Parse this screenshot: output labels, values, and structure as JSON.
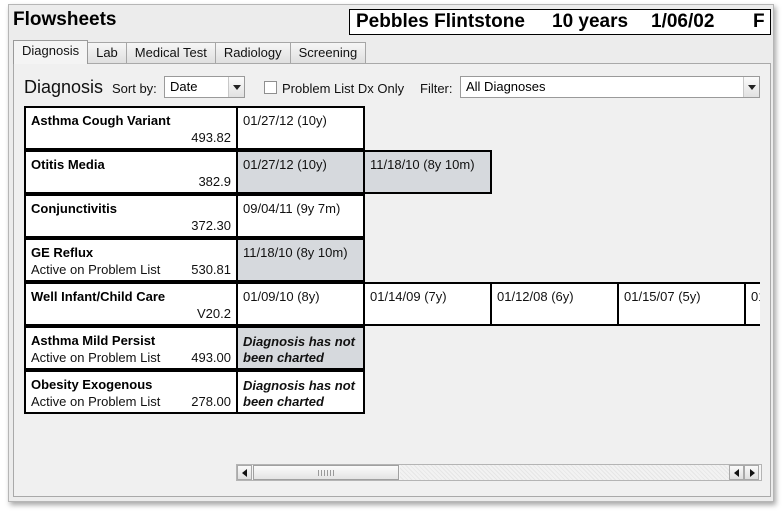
{
  "window": {
    "title": "Flowsheets"
  },
  "patient": {
    "name": "Pebbles Flintstone",
    "age": "10 years",
    "dob": "1/06/02",
    "sex": "F"
  },
  "tabs": [
    {
      "label": "Diagnosis",
      "active": true
    },
    {
      "label": "Lab"
    },
    {
      "label": "Medical Test"
    },
    {
      "label": "Radiology"
    },
    {
      "label": "Screening"
    }
  ],
  "toolbar": {
    "heading": "Diagnosis",
    "sort_label": "Sort by:",
    "sort_value": "Date",
    "problem_list_label": "Problem List Dx Only",
    "problem_list_checked": false,
    "filter_label": "Filter:",
    "filter_value": "All Diagnoses"
  },
  "rows": [
    {
      "name": "Asthma Cough Variant",
      "status": "",
      "code": "493.82",
      "entries": [
        {
          "text": "01/27/12 (10y)",
          "shade": "white"
        }
      ]
    },
    {
      "name": "Otitis Media",
      "status": "",
      "code": "382.9",
      "entries": [
        {
          "text": "01/27/12 (10y)",
          "shade": "grey"
        },
        {
          "text": "11/18/10 (8y 10m)",
          "shade": "grey"
        }
      ]
    },
    {
      "name": "Conjunctivitis",
      "status": "",
      "code": "372.30",
      "entries": [
        {
          "text": "09/04/11 (9y 7m)",
          "shade": "white"
        }
      ]
    },
    {
      "name": "GE Reflux",
      "status": "Active on Problem List",
      "code": "530.81",
      "entries": [
        {
          "text": "11/18/10 (8y 10m)",
          "shade": "grey"
        }
      ]
    },
    {
      "name": "Well Infant/Child Care",
      "status": "",
      "code": "V20.2",
      "entries": [
        {
          "text": "01/09/10 (8y)",
          "shade": "blue"
        },
        {
          "text": "01/14/09 (7y)",
          "shade": "blue"
        },
        {
          "text": "01/12/08 (6y)",
          "shade": "blue"
        },
        {
          "text": "01/15/07 (5y)",
          "shade": "blue"
        },
        {
          "text": "01/1",
          "shade": "white"
        }
      ]
    },
    {
      "name": "Asthma Mild Persist",
      "status": "Active on Problem List",
      "code": "493.00",
      "entries": [
        {
          "text": "Diagnosis has not been charted",
          "shade": "grey",
          "not_charted": true
        }
      ]
    },
    {
      "name": "Obesity Exogenous",
      "status": "Active on Problem List",
      "code": "278.00",
      "entries": [
        {
          "text": "Diagnosis has not been charted",
          "shade": "white",
          "not_charted": true
        }
      ]
    }
  ],
  "icons": {
    "sort_dropdown": "chevron-down-icon",
    "filter_dropdown": "chevron-down-icon",
    "scroll_left": "arrow-left-icon",
    "scroll_right": "arrow-right-icon"
  },
  "colors": {
    "grey_cell": "#d6d9dd",
    "row_border": "#000000",
    "scroll_divider": "#3e6ea8"
  }
}
